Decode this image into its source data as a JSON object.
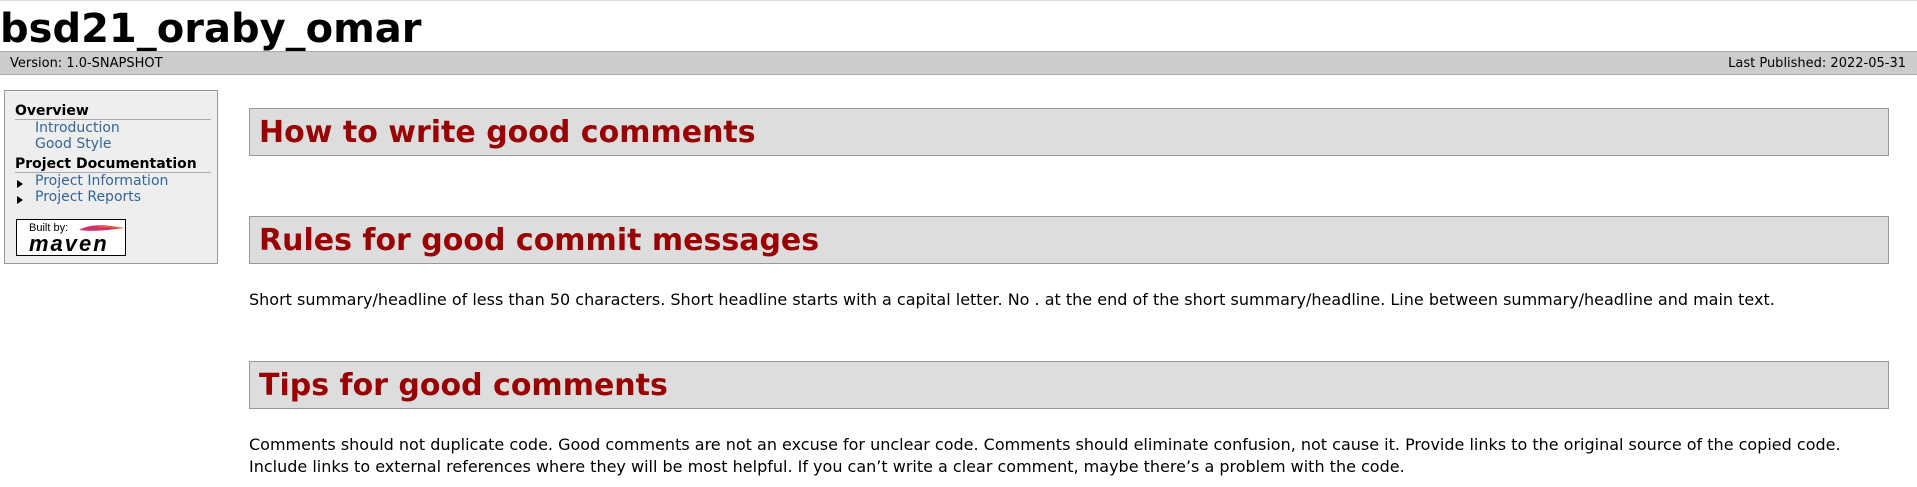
{
  "banner": {
    "title": "bsd21_oraby_omar"
  },
  "breadcrumbs": {
    "version": "Version: 1.0-SNAPSHOT",
    "published": "Last Published: 2022-05-31"
  },
  "sidebar": {
    "sections": [
      {
        "title": "Overview",
        "items": [
          "Introduction",
          "Good Style"
        ]
      },
      {
        "title": "Project Documentation",
        "items": [
          "Project Information",
          "Project Reports"
        ]
      }
    ],
    "powered_by": {
      "built": "Built by:",
      "maven": "maven"
    }
  },
  "content": {
    "sections": [
      {
        "heading": "How to write good comments",
        "text": ""
      },
      {
        "heading": "Rules for good commit messages",
        "text": "Short summary/headline of less than 50 characters. Short headline starts with a capital letter. No . at the end of the short summary/headline. Line between summary/headline and main text."
      },
      {
        "heading": "Tips for good comments",
        "text_line1": "Comments should not duplicate code. Good comments are not an excuse for unclear code. Comments should eliminate confusion, not cause it. Provide links to the original source of the copied code.",
        "text_line2": "Include links to external references where they will be most helpful. If you can’t write a clear comment, maybe there’s a problem with the code."
      }
    ]
  },
  "colors": {
    "heading": "#990000",
    "link": "#336699",
    "header_bg": "#dddddd",
    "breadcrumbs_bg": "#cccccc"
  }
}
